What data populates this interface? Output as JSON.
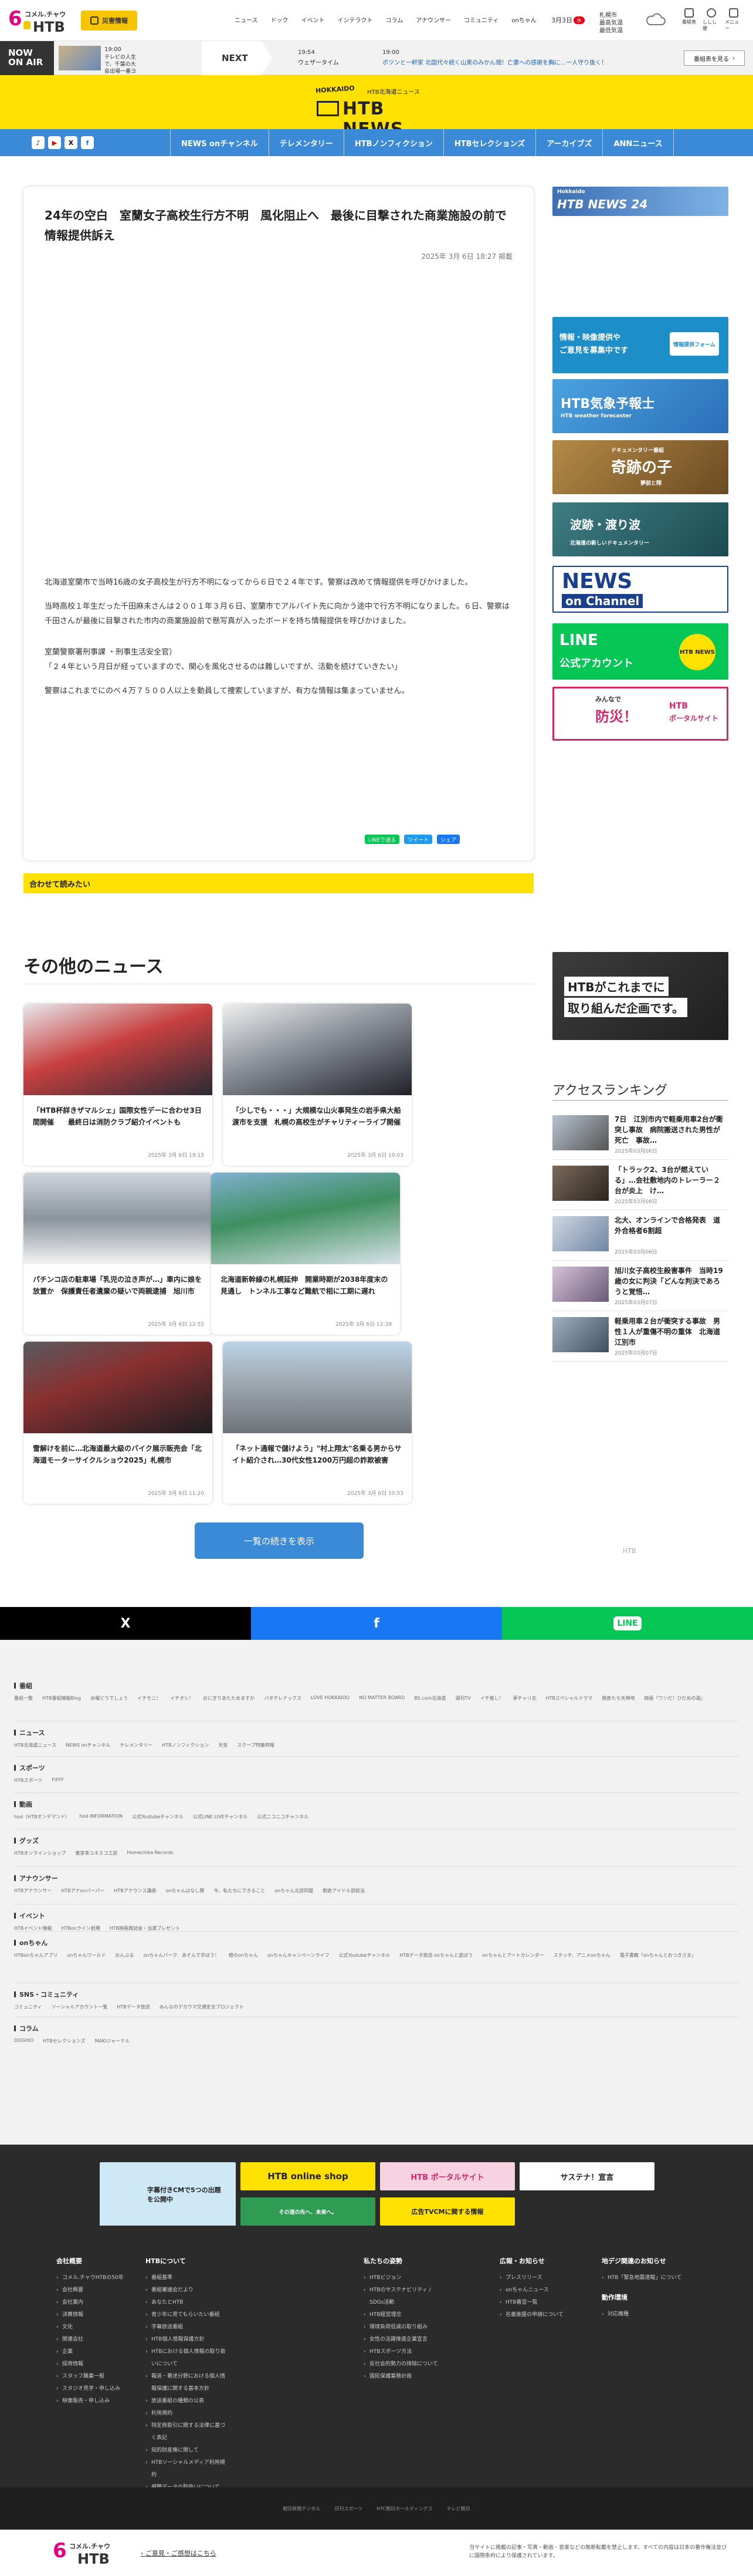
{
  "logo": {
    "six": "6",
    "sub": "コメル.チャウ",
    "htb": "HTB"
  },
  "header": {
    "disaster_label": "災害情報",
    "nav": [
      "ニュース",
      "ドック",
      "イベント",
      "インテラクト",
      "コラム",
      "アナウンサー",
      "コミュニティ",
      "onちゃん"
    ],
    "date": "3月3日",
    "date_badge": "水",
    "weather_city": "札幌市",
    "weather_text": "最高気温 ",
    "weather_text2": "最低気温",
    "icon_labels": [
      "番組表",
      "ログイン",
      "メニュー"
    ],
    "icon_label_extra": "予定",
    "icon_label_user": "ししし便"
  },
  "onair": {
    "label1": "NOW",
    "label2": "ON AIR",
    "now_time": "19:00",
    "now_program": "テレビの人生で、千葉の大会出場一番ヨコ本",
    "next_label": "NEXT",
    "next_time": "19:54",
    "next_program": "ウェザータイム",
    "ticker_time": "19:00",
    "ticker_text": "ポツンと一軒家 北国代々続く山奥のみかん畑！亡妻への感謝を胸に…一人守り抜く！",
    "program_btn": "番組表を見る"
  },
  "brand": {
    "small": "HOKKAIDO",
    "jp": "HTB北海道ニュース",
    "big": "HTB NEWS"
  },
  "nav": {
    "social": [
      "♪",
      "▶",
      "X",
      "f"
    ],
    "links": [
      "NEWS onチャンネル",
      "テレメンタリー",
      "HTBノンフィクション",
      "HTBセレクションズ",
      "アーカイブズ",
      "ANNニュース"
    ]
  },
  "article": {
    "title": "24年の空白　室蘭女子高校生行方不明　風化阻止へ　最後に目撃された商業施設の前で情報提供訴え",
    "date": "2025年 3月 6日 18:27 掲載",
    "paragraphs": [
      "北海道室蘭市で当時16歳の女子高校生が行方不明になってから６日で２４年です。警察は改めて情報提供を呼びかけました。",
      "当時高校１年生だった千田麻未さんは２００１年３月６日、室蘭市でアルバイト先に向かう途中で行方不明になりました。６日、警察は千田さんが最後に目撃された市内の商業施設前で懸写真が入ったボードを持ち情報提供を呼びかけました。",
      "室蘭警察署刑事課 ・刑事生活安全官）\n「２４年という月日が経っていますので、関心を風化させるのは難しいですが、活動を続けていきたい」",
      "警察はこれまでにのべ４万７５００人以上を動員して捜索していますが、有力な情報は集まっていません。"
    ],
    "share": [
      "LINEで送る",
      "ツイート",
      "シェア"
    ],
    "related": "合わせて読みたい"
  },
  "sidebar": {
    "news24": "HTB NEWS 24",
    "news24_sub": "Hokkaido",
    "recruit1": "情報・映像提供や",
    "recruit2": "ご意見を募集中です",
    "recruit_btn": "情報提供フォーム",
    "weather1": "HTB気象予報士",
    "weather2": "HTB weather forecaster",
    "kiseki1": "ドキュメンタリー番組",
    "kiseki2": "奇跡の子",
    "kiseki3": "夢前と翔",
    "namiuchi1": "波跡・渡り波",
    "namiuchi2": "北海道の新しいドキュメンタリー",
    "newson1": "NEWS",
    "newson2": "on Channel",
    "line1": "LINE",
    "line2": "公式アカウント",
    "line3": "HTB NEWS",
    "bousai1": "みんなで",
    "bousai2": "防災！",
    "bousai3": "HTB",
    "bousai4": "ポータルサイト",
    "kikaku1": "HTBがこれまでに",
    "kikaku2": "取り組んだ企画です。",
    "ranking_title": "アクセスランキング",
    "ranking": [
      {
        "title": "7日　江別市内で軽乗用車2台が衝突し事故　病院搬送された男性が死亡　事故…",
        "date": "2025年03月06日"
      },
      {
        "title": "「トラック2、3台が燃えている」…会社敷地内のトレーラー２台が炎上　け…",
        "date": "2025年03月06日"
      },
      {
        "title": "北大、オンラインで合格発表　道外合格者6割超",
        "date": "2025年03月06日"
      },
      {
        "title": "旭川女子高校生殺害事件　当時19歳の女に判決「どんな判決であろうと覚悟…",
        "date": "2025年03月07日"
      },
      {
        "title": "軽乗用車２台が衝突する事故　男性１人が重傷不明の重体　北海道江別市",
        "date": "2025年03月07日"
      }
    ],
    "bottom_logo": "HTB"
  },
  "other": {
    "heading": "その他のニュース",
    "cards": [
      {
        "title": "「HTB杯詳きザマルシェ」国際女性デーに合わせ3日間開催　　最終日は消防クラブ紹介イベントも",
        "date": "2025年 3月 6日 19:15"
      },
      {
        "title": "「少しでも・・・」大規模な山火事発生の岩手県大船渡市を支援　札幌の高校生がチャリティーライブ開催",
        "date": "2025年 3月 6日 19:03"
      },
      {
        "title": "パチンコ店の駐車場「乳児の泣き声が…」車内に娘を放置か　保護責任者遺棄の疑いで両親逮捕　旭川市",
        "date": "2025年 3月 6日 12:55"
      },
      {
        "title": "北海道新幹線の札幌延伸　開業時期が2038年度末の見通し　トンネル工事など難航で相に工期に遅れ",
        "date": "2025年 3月 6日 12:39"
      },
      {
        "title": "雪解けを前に…北海道最大級のバイク展示販売会「北海道モーターサイクルショウ2025」札幌市",
        "date": "2025年 3月 6日 11:20"
      },
      {
        "title": "「ネット通報で儲けよう」\"村上翔太\"名乗る男からサイト紹介され…30代女性1200万円超の詐欺被害",
        "date": "2025年 3月 6日 10:53"
      }
    ],
    "more_btn": "一覧の続きを表示"
  },
  "sharebar": [
    "X",
    "f",
    "LINE"
  ],
  "sitemap": [
    {
      "heading": "番組",
      "links": [
        "番組一覧",
        "HTB番組情報Blog",
        "水曜どうでしょう",
        "イチモニ！",
        "イチオシ！",
        "おにぎりあたためますか",
        "パタデレナックス",
        "LOVE HOKKAIDO",
        "NO MATTER BOARD",
        "BS.com北海道",
        "週刊TV",
        "イチ推し！",
        "夢チャリ北",
        "HTBスペシャルドラマ",
        "朝倉たち天神地",
        "映画『ワンだ！ひだめの週』"
      ]
    },
    {
      "heading": "ニュース",
      "links": [
        "HTB北海道ニュース",
        "NEWS onチャンネル",
        "テレメンタリー",
        "HTBノンフィクション",
        "天気",
        "スクープ特集特報"
      ]
    },
    {
      "heading": "スポーツ",
      "links": [
        "HTBスポーツ",
        "FIFFF"
      ]
    },
    {
      "heading": "動画",
      "links": [
        "hod（HTBオンデマンド）",
        "hod INFORMATION",
        "公式Youtubeチャンネル",
        "公式LINE LIVEチャンネル",
        "公式ニコニコチャンネル"
      ]
    },
    {
      "heading": "グッズ",
      "links": [
        "HTBオンラインショップ",
        "東芽茶ユネスコ工房",
        "Homechika Records"
      ]
    },
    {
      "heading": "アナウンサー",
      "links": [
        "HTBアナウンサー",
        "HTBアナonパーパー",
        "HTBアナウンス講座",
        "onちゃんはなし隊",
        "今、私たちにできること",
        "onちゃん北部同盟",
        "朝倉アイドル部担当"
      ]
    },
    {
      "heading": "イベント",
      "links": [
        "HTBイベント情報",
        "HTBonライン創場",
        "HTB映画賞試会・当選プレゼント"
      ]
    },
    {
      "heading": "onちゃん",
      "links": [
        "HTBonちゃんアプリ",
        "onちゃんワールド",
        "おんぶる",
        "onちゃんパーク　あそんで学ぼう！",
        "橙のonちゃん",
        "onちゃんキャンペーンライフ",
        "公式Youtubeチャンネル",
        "HTBデータ放送 onちゃんと遊ぼう",
        "onちゃんとアートカレンダー",
        "ステッチ、アニメonちゃん",
        "電子書籍「onちゃんとおつきさま」"
      ]
    },
    {
      "heading": "SNS・コミュニティ",
      "links": [
        "コミュニティ",
        "ソーシャルアカウント一覧",
        "HTBデータ放送",
        "みんなのデカウマ交通安全プロジェクト"
      ]
    },
    {
      "heading": "コラム",
      "links": [
        "DOGHIO",
        "HTBセレクションズ",
        "MAKIジャーナル"
      ]
    }
  ],
  "banners": [
    "字幕付きCMで5つの出題を公開中",
    "HTB online shop",
    "HTB ポータルサイト",
    "サステナ！宣言",
    "その道の先へ、未来へ。",
    "広告TVCMに関する情報"
  ],
  "footer": {
    "cols": [
      {
        "heading": "会社概要",
        "items": [
          "コメル.チャウHTBの50年",
          "会社概要",
          "会社案内",
          "決算情報",
          "文化",
          "関連会社",
          "企業",
          "採用情報",
          "スタッフ職業一般",
          "スタジオ見学・申し込み",
          "映像販売・申し込み"
        ]
      },
      {
        "heading": "HTBについて",
        "items": [
          "番組基準",
          "番組審議会だより",
          "あなたとHTB",
          "青少年に見てもらいたい番組",
          "字幕放送番組",
          "HTB個人情報保護方針",
          "HTBにおける個人情報の取り扱いについて",
          "報道・著述分野における個人情報保護に関する基本方針",
          "放送番組の種類の公表",
          "利用規約",
          "特定商取引に関する法律に基づく表記",
          "知的財産権に関して",
          "HTBソーシャルメディア利用規約",
          "視聴データの取扱いについて"
        ]
      },
      {
        "heading": "私たちの姿勢",
        "items": [
          "HTBビジョン",
          "HTBのサステナビリティ / SDGs活動",
          "HTB経営理念",
          "環境負荷低減の取り組み",
          "女性の活躍推進企業宣言",
          "HTBスポーツ方法",
          "反社会的勢力の排除について",
          "国民保護業務計画"
        ]
      },
      {
        "heading": "広報・お知らせ",
        "items": [
          "プレスリリース",
          "onちゃんニュース",
          "HTB番宣一覧",
          "名義後援の申請について"
        ]
      },
      {
        "heading": "地デジ関連のお知らせ",
        "items": [
          "HTB「緊急地震速報」について"
        ],
        "heading2": "動作環境",
        "items2": [
          "対応機種"
        ]
      }
    ]
  },
  "copyline": [
    "朝日新聞デジタル",
    "日刊スポーツ",
    "HTC朝日ホールディングス",
    "テレビ朝日"
  ],
  "bottombar": {
    "link": "ご意見・ご感想はこちら",
    "notice": "当サイトに掲載の記事・写真・動画・音楽などの無断転載を禁止します。すべての内容は日本の著作権法並びに国際条約により保護されています。"
  },
  "colors": {
    "yellow": "#ffe100",
    "blue": "#3a8ad8",
    "dark": "#2b2b2b",
    "pink": "#e4007f"
  }
}
